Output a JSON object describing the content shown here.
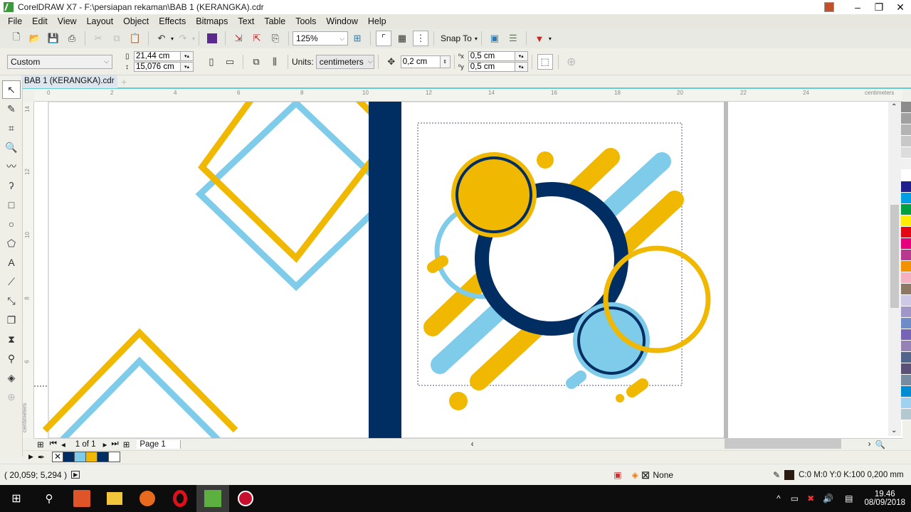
{
  "window": {
    "title": "CorelDRAW X7 - F:\\persiapan rekaman\\BAB 1 (KERANGKA).cdr",
    "controls": {
      "minimize": "–",
      "restore": "❐",
      "close": "✕"
    }
  },
  "menu": [
    "File",
    "Edit",
    "View",
    "Layout",
    "Object",
    "Effects",
    "Bitmaps",
    "Text",
    "Table",
    "Tools",
    "Window",
    "Help"
  ],
  "toolbar": {
    "zoom_level": "125%",
    "snap_to_label": "Snap To",
    "icons": [
      "new-icon",
      "open-icon",
      "save-icon",
      "print-icon",
      "cut-icon",
      "copy-icon",
      "paste-icon",
      "undo-icon",
      "redo-icon",
      "corel-connect-icon",
      "import-icon",
      "export-icon",
      "publish-pdf-icon"
    ]
  },
  "property_bar": {
    "page_preset": "Custom",
    "page_width": "21,44 cm",
    "page_height": "15,076 cm",
    "units_label": "Units:",
    "units_value": "centimeters",
    "nudge": "0,2 cm",
    "duplicate_x": "0,5 cm",
    "duplicate_y": "0,5 cm"
  },
  "document_tab": "BAB 1 (KERANGKA).cdr",
  "ruler": {
    "unit_label": "centimeters",
    "h_ticks": [
      "0",
      "2",
      "4",
      "6",
      "8",
      "10",
      "12",
      "14",
      "16",
      "18",
      "20",
      "22",
      "24"
    ],
    "v_ticks": [
      "14",
      "12",
      "10",
      "8",
      "6"
    ],
    "v_unit_label": "centimeters"
  },
  "page_nav": {
    "page_counter": "1 of 1",
    "page_tab": "Page 1"
  },
  "document_palette": [
    "#002d62",
    "#7ecbea",
    "#f0b800",
    "#002d62",
    "#ffffff"
  ],
  "color_palette": [
    "#8c8c8c",
    "#a0a0a0",
    "#b4b4b4",
    "#c8c8c8",
    "#dcdcdc",
    "#f0f0f0",
    "#ffffff",
    "#1e1e8c",
    "#009fe3",
    "#00a040",
    "#ffed00",
    "#e30613",
    "#e6007e",
    "#b83a8e",
    "#f39200",
    "#f4afc0",
    "#8c7864",
    "#cdc8e6",
    "#a096c8",
    "#6e8cc8",
    "#7864b4",
    "#9682b4",
    "#50648c",
    "#5a5078",
    "#788ca0",
    "#008cd2",
    "#a0d2f0",
    "#b4c8d2"
  ],
  "status": {
    "cursor_position": "( 20,059; 5,294 )",
    "fill_label": "None",
    "outline_info": "C:0 M:0 Y:0 K:100  0,200 mm"
  },
  "taskbar": {
    "time": "19.46",
    "date": "08/09/2018"
  },
  "artwork": {
    "colors": {
      "navy": "#002d62",
      "sky": "#7ecbea",
      "gold": "#f0b800"
    }
  }
}
